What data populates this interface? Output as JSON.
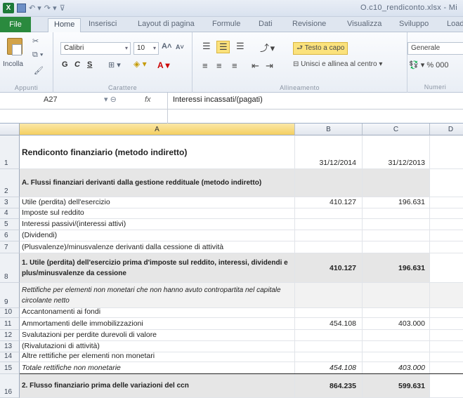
{
  "window": {
    "title": "O.c10_rendiconto.xlsx - Mi",
    "app_icon": "X"
  },
  "tabs": [
    "File",
    "Home",
    "Inserisci",
    "Layout di pagina",
    "Formule",
    "Dati",
    "Revisione",
    "Visualizza",
    "Sviluppo",
    "Load"
  ],
  "ribbon": {
    "clipboard": {
      "paste": "Incolla",
      "label": "Appunti"
    },
    "font": {
      "name": "Calibri",
      "size": "10",
      "bold": "G",
      "italic": "C",
      "underline": "S",
      "label": "Carattere"
    },
    "alignment": {
      "wrap": "Testo a capo",
      "merge": "Unisci e allinea al centro",
      "label": "Allineamento"
    },
    "number": {
      "format": "Generale",
      "symbols": "% 000",
      "label": "Numeri"
    }
  },
  "formula_bar": {
    "cell_ref": "A27",
    "fx": "fx",
    "content": "Interessi incassati/(pagati)"
  },
  "columns": [
    "A",
    "B",
    "C",
    "D"
  ],
  "rows": [
    {
      "n": "1",
      "a": "Rendiconto finanziario (metodo indiretto)",
      "b": "31/12/2014",
      "c": "31/12/2013"
    },
    {
      "n": "2",
      "a": "A. Flussi finanziari derivanti dalla gestione reddituale (metodo indiretto)",
      "b": "",
      "c": ""
    },
    {
      "n": "3",
      "a": "Utile (perdita) dell'esercizio",
      "b": "410.127",
      "c": "196.631"
    },
    {
      "n": "4",
      "a": "Imposte sul reddito",
      "b": "",
      "c": ""
    },
    {
      "n": "5",
      "a": "Interessi passivi/(interessi attivi)",
      "b": "",
      "c": ""
    },
    {
      "n": "6",
      "a": "(Dividendi)",
      "b": "",
      "c": ""
    },
    {
      "n": "7",
      "a": "(Plusvalenze)/minusvalenze derivanti dalla cessione di attività",
      "b": "",
      "c": ""
    },
    {
      "n": "8",
      "a": "1. Utile (perdita) dell'esercizio prima d'imposte sul reddito, interessi, dividendi e plus/minusvalenze da cessione",
      "b": "410.127",
      "c": "196.631"
    },
    {
      "n": "9",
      "a": "Rettifiche per elementi non monetari che non hanno avuto contropartita nel capitale circolante netto",
      "b": "",
      "c": ""
    },
    {
      "n": "10",
      "a": "Accantonamenti ai fondi",
      "b": "",
      "c": ""
    },
    {
      "n": "11",
      "a": "Ammortamenti delle immobilizzazioni",
      "b": "454.108",
      "c": "403.000"
    },
    {
      "n": "12",
      "a": "Svalutazioni per perdite durevoli di valore",
      "b": "",
      "c": ""
    },
    {
      "n": "13",
      "a": "(Rivalutazioni di attività)",
      "b": "",
      "c": ""
    },
    {
      "n": "14",
      "a": "Altre rettifiche per elementi non monetari",
      "b": "",
      "c": ""
    },
    {
      "n": "15",
      "a": "Totale rettifiche non monetarie",
      "b": "454.108",
      "c": "403.000"
    },
    {
      "n": "16",
      "a": "2. Flusso finanziario prima delle variazioni del ccn",
      "b": "864.235",
      "c": "599.631"
    }
  ]
}
